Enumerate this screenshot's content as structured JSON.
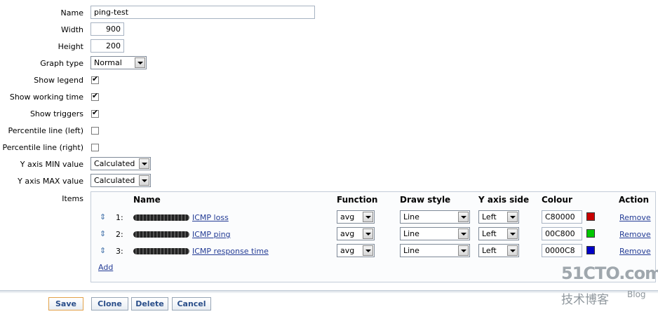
{
  "form": {
    "name_label": "Name",
    "name_value": "ping-test",
    "width_label": "Width",
    "width_value": "900",
    "height_label": "Height",
    "height_value": "200",
    "graph_type_label": "Graph type",
    "graph_type_value": "Normal",
    "show_legend_label": "Show legend",
    "show_legend_checked": true,
    "show_working_time_label": "Show working time",
    "show_working_time_checked": true,
    "show_triggers_label": "Show triggers",
    "show_triggers_checked": true,
    "percentile_left_label": "Percentile line (left)",
    "percentile_left_checked": false,
    "percentile_right_label": "Percentile line (right)",
    "percentile_right_checked": false,
    "ymin_label": "Y axis MIN value",
    "ymin_value": "Calculated",
    "ymax_label": "Y axis MAX value",
    "ymax_value": "Calculated",
    "items_label": "Items"
  },
  "items_table": {
    "headers": {
      "name": "Name",
      "function": "Function",
      "draw_style": "Draw style",
      "y_axis_side": "Y axis side",
      "colour": "Colour",
      "action": "Action"
    },
    "rows": [
      {
        "index": "1:",
        "name": "ICMP loss",
        "function": "avg",
        "draw_style": "Line",
        "y_axis_side": "Left",
        "colour": "C80000",
        "swatch": "#c80000",
        "action": "Remove"
      },
      {
        "index": "2:",
        "name": "ICMP ping",
        "function": "avg",
        "draw_style": "Line",
        "y_axis_side": "Left",
        "colour": "00C800",
        "swatch": "#00c800",
        "action": "Remove"
      },
      {
        "index": "3:",
        "name": "ICMP response time",
        "function": "avg",
        "draw_style": "Line",
        "y_axis_side": "Left",
        "colour": "0000C8",
        "swatch": "#0000c8",
        "action": "Remove"
      }
    ],
    "add_label": "Add"
  },
  "buttons": {
    "save": "Save",
    "clone": "Clone",
    "delete": "Delete",
    "cancel": "Cancel"
  },
  "watermark": {
    "logo": "51CTO.com",
    "sub": "技术博客",
    "blog": "Blog"
  }
}
